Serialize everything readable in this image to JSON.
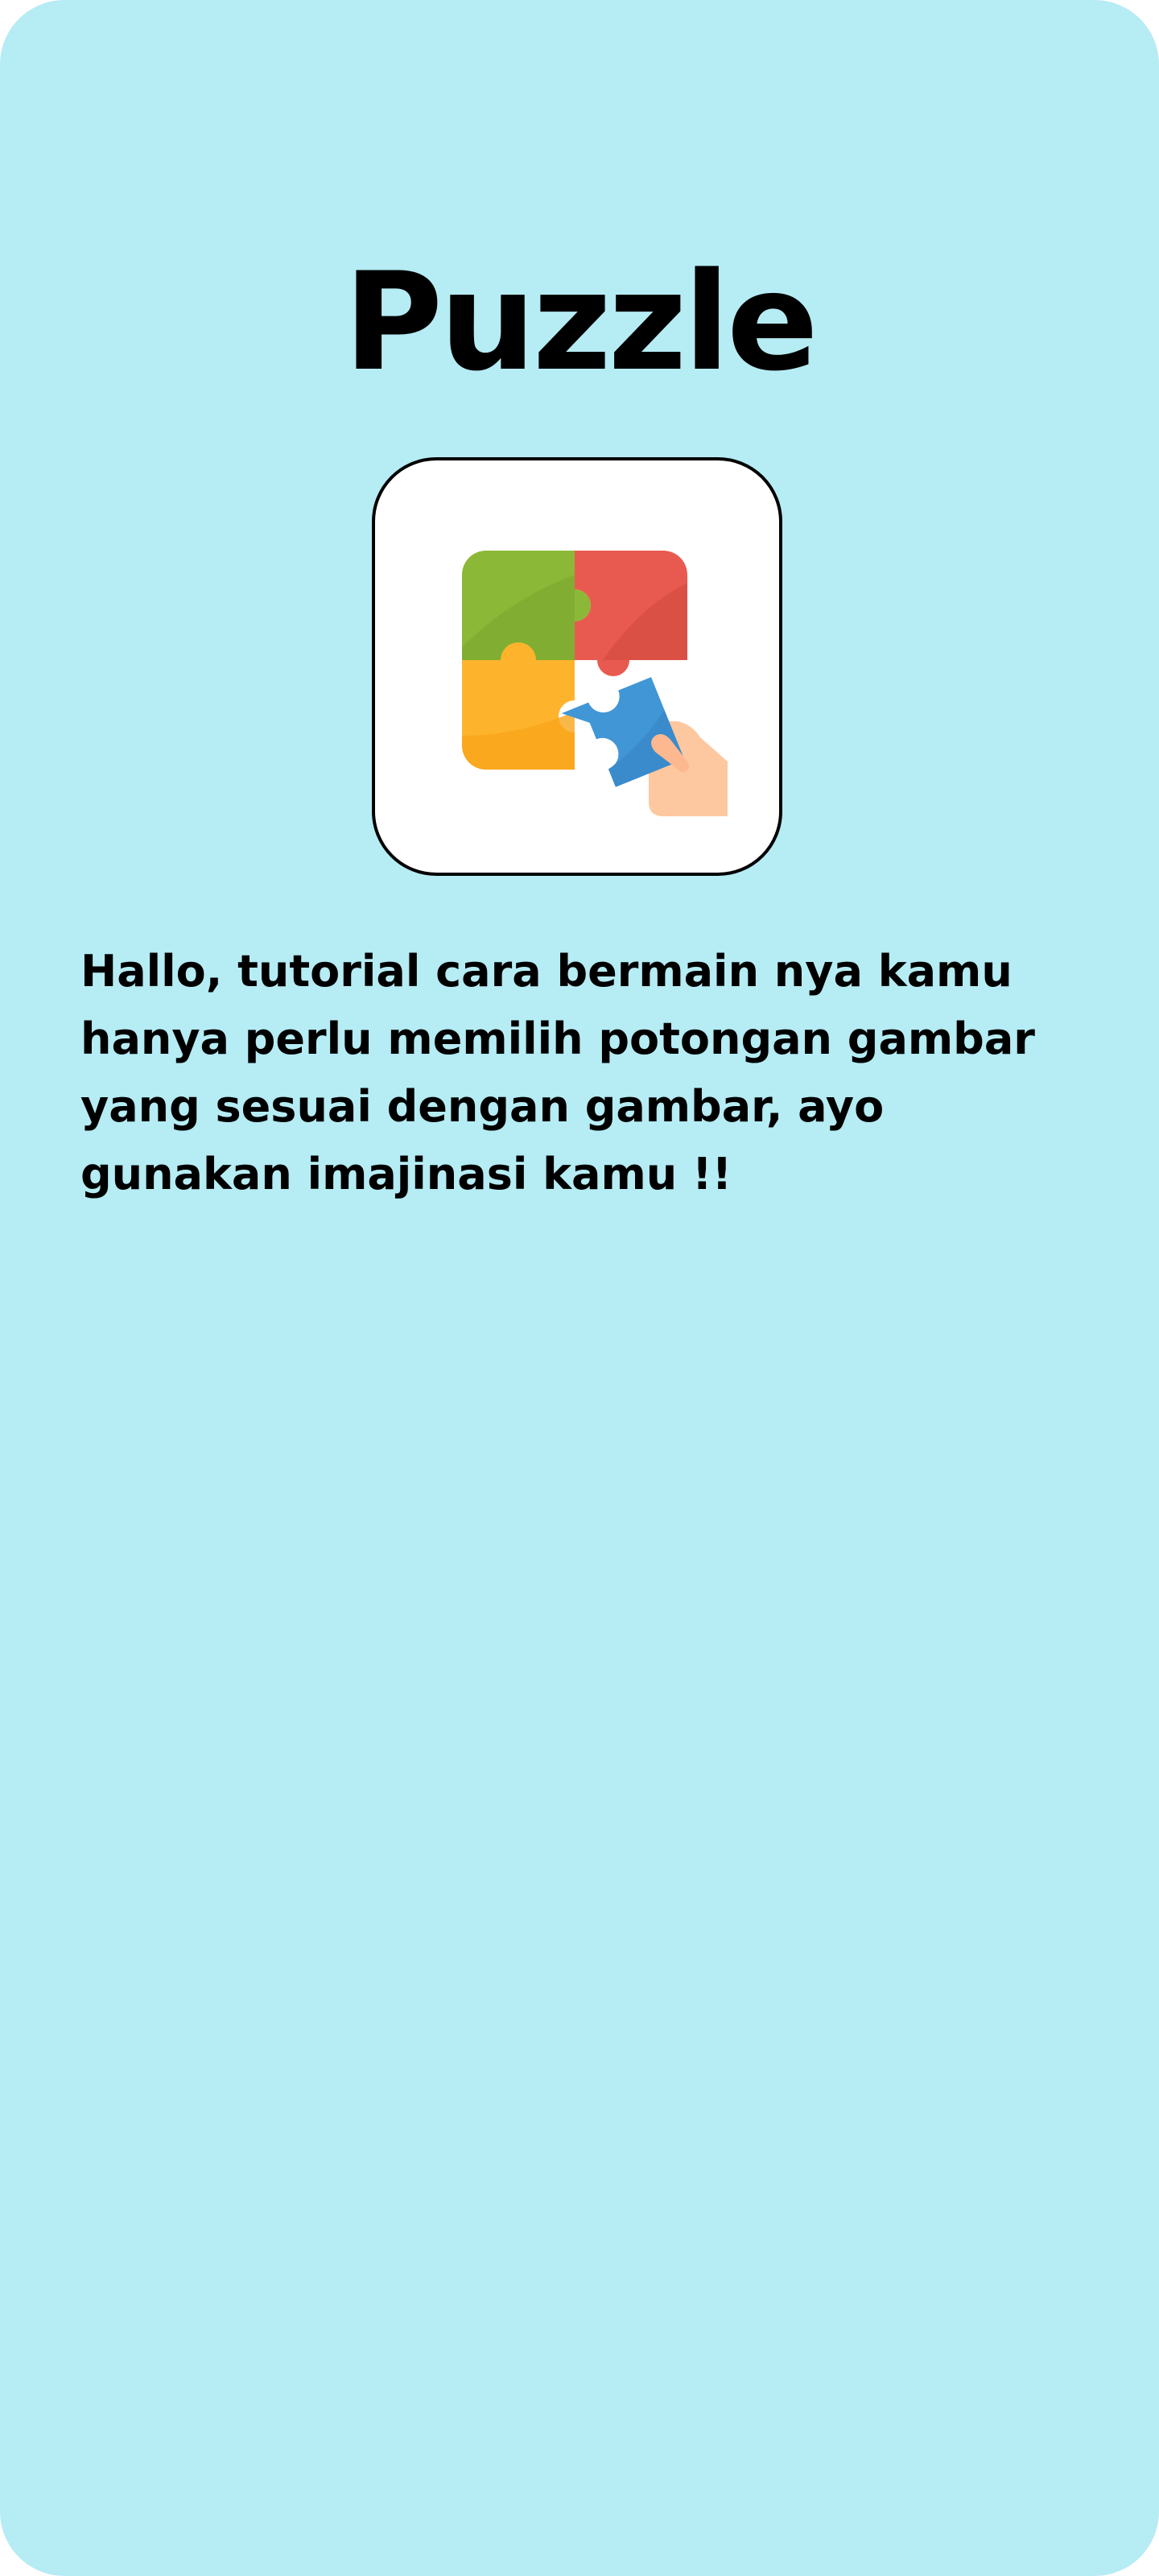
{
  "app": {
    "title": "Puzzle",
    "icon": "puzzle-pieces-hand-icon"
  },
  "tutorial": {
    "text": "Hallo, tutorial cara bermain nya kamu hanya perlu memilih potongan gambar yang sesuai dengan gambar, ayo gunakan imajinasi kamu !!"
  },
  "colors": {
    "background": "#b6ecf4",
    "card": "#ffffff",
    "text": "#000000",
    "piece_green": "#8bb836",
    "piece_red": "#e85a4f",
    "piece_yellow": "#fdb42c",
    "piece_blue": "#4196d6",
    "hand": "#fdc8a0"
  }
}
